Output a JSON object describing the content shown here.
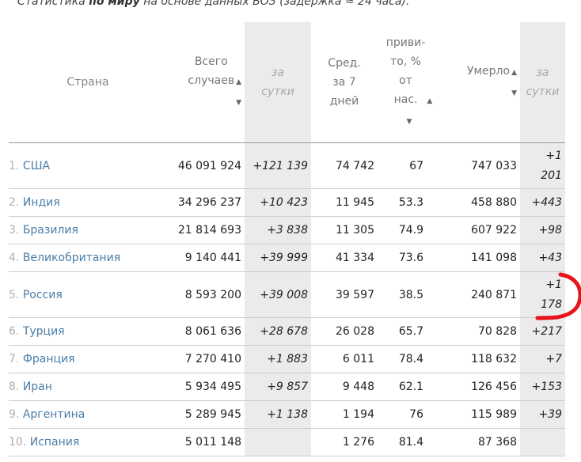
{
  "caption": {
    "before": "Статистика ",
    "bold": "по миру",
    "after": " на основе данных ВОЗ (задержка ≈ 24 часа)."
  },
  "headers": {
    "country": "Страна",
    "total_1": "Всего",
    "total_2": "случаев",
    "daily_1": "за",
    "daily_2": "сутки",
    "avg_1": "Сред.",
    "avg_2": "за 7",
    "avg_3": "дней",
    "vacc_1": "приви-",
    "vacc_2": "то, %",
    "vacc_3": "от",
    "vacc_4": "нас.",
    "deaths_1": "Умерло",
    "ddaily_1": "за",
    "ddaily_2": "сутки"
  },
  "rows": [
    {
      "idx": "1.",
      "country": "США",
      "total": "46 091 924",
      "daily": "+121 139",
      "avg": "74 742",
      "vacc": "67",
      "deaths": "747 033",
      "ddaily_1": "+1",
      "ddaily_2": "201"
    },
    {
      "idx": "2.",
      "country": "Индия",
      "total": "34 296 237",
      "daily": "+10 423",
      "avg": "11 945",
      "vacc": "53.3",
      "deaths": "458 880",
      "ddaily_1": "+443",
      "ddaily_2": ""
    },
    {
      "idx": "3.",
      "country": "Бразилия",
      "total": "21 814 693",
      "daily": "+3 838",
      "avg": "11 305",
      "vacc": "74.9",
      "deaths": "607 922",
      "ddaily_1": "+98",
      "ddaily_2": ""
    },
    {
      "idx": "4.",
      "country": "Великобритания",
      "total": "9 140 441",
      "daily": "+39 999",
      "avg": "41 334",
      "vacc": "73.6",
      "deaths": "141 098",
      "ddaily_1": "+43",
      "ddaily_2": ""
    },
    {
      "idx": "5.",
      "country": "Россия",
      "total": "8 593 200",
      "daily": "+39 008",
      "avg": "39 597",
      "vacc": "38.5",
      "deaths": "240 871",
      "ddaily_1": "+1",
      "ddaily_2": "178"
    },
    {
      "idx": "6.",
      "country": "Турция",
      "total": "8 061 636",
      "daily": "+28 678",
      "avg": "26 028",
      "vacc": "65.7",
      "deaths": "70 828",
      "ddaily_1": "+217",
      "ddaily_2": ""
    },
    {
      "idx": "7.",
      "country": "Франция",
      "total": "7 270 410",
      "daily": "+1 883",
      "avg": "6 011",
      "vacc": "78.4",
      "deaths": "118 632",
      "ddaily_1": "+7",
      "ddaily_2": ""
    },
    {
      "idx": "8.",
      "country": "Иран",
      "total": "5 934 495",
      "daily": "+9 857",
      "avg": "9 448",
      "vacc": "62.1",
      "deaths": "126 456",
      "ddaily_1": "+153",
      "ddaily_2": ""
    },
    {
      "idx": "9.",
      "country": "Аргентина",
      "total": "5 289 945",
      "daily": "+1 138",
      "avg": "1 194",
      "vacc": "76",
      "deaths": "115 989",
      "ddaily_1": "+39",
      "ddaily_2": ""
    },
    {
      "idx": "10.",
      "country": "Испания",
      "total": "5 011 148",
      "daily": "",
      "avg": "1 276",
      "vacc": "81.4",
      "deaths": "87 368",
      "ddaily_1": "",
      "ddaily_2": ""
    }
  ],
  "icons": {
    "sort": "sort-arrows-icon"
  },
  "colors": {
    "link": "#4a7da8",
    "shade": "#ebebeb",
    "annotation": "#e8141b"
  }
}
